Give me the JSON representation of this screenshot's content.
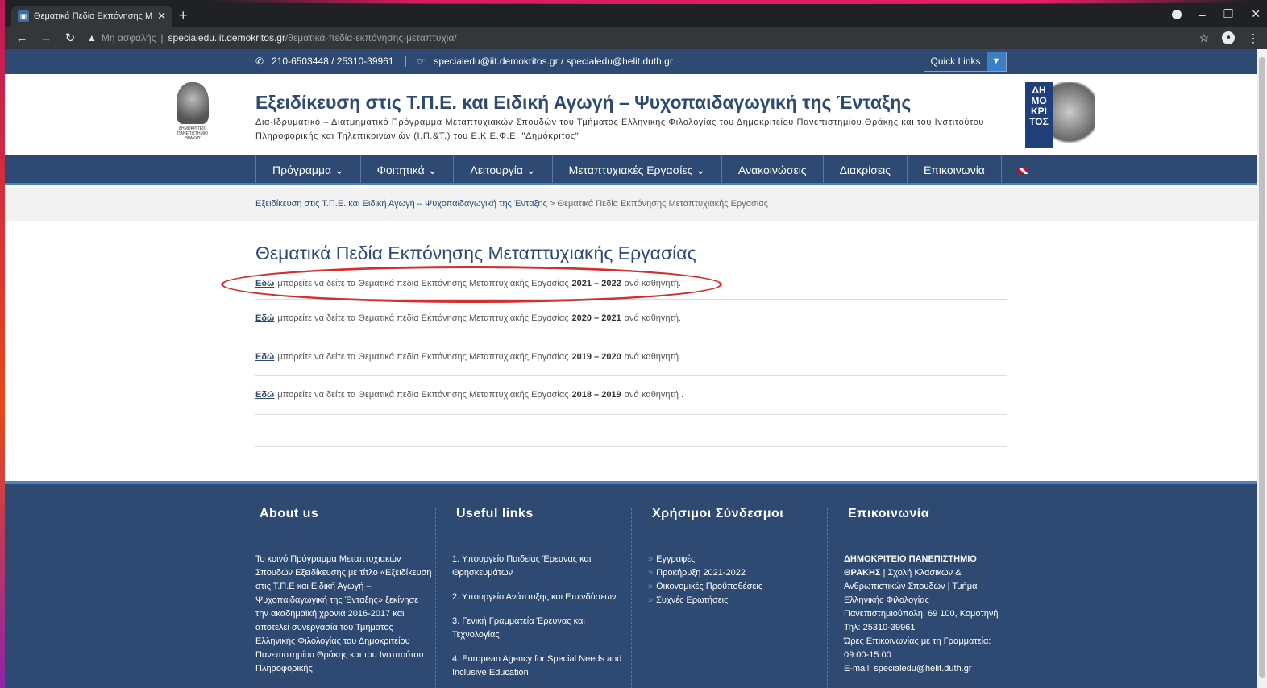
{
  "browser": {
    "tab_title": "Θεματικά Πεδία Εκπόνησης Με",
    "url_warning": "Μη ασφαλής",
    "url_host": "specialedu.iit.demokritos.gr",
    "url_path": "/θεματικά-πεδία-εκπόνησης-μεταπτυχια/"
  },
  "topbar": {
    "phone": "210-6503448 / 25310-39961",
    "email": "specialedu@iit.demokritos.gr / specialedu@helit.duth.gr",
    "quick_links": "Quick Links"
  },
  "header": {
    "title": "Εξειδίκευση στις Τ.Π.Ε. και Ειδική Αγωγή – Ψυχοπαιδαγωγική της Ένταξης",
    "subtitle": "Δια-Ιδρυματικό – Διατμηματικό Πρόγραμμα Μεταπτυχιακών Σπουδών του Τμήματος Ελληνικής Φιλολογίας του Δημοκριτείου Πανεπιστημίου Θράκης και του Ινστιτούτου Πληροφορικής και Τηλεπικοινωνιών (Ι.Π.&Τ.) του Ε.Κ.Ε.Φ.Ε. \"Δημόκριτος\"",
    "logo_left_caption": "ΔΗΜΟΚΡΙΤΕΙΟ ΠΑΝΕΠΙΣΤΗΜΙΟ ΘΡΑΚΗΣ",
    "logo_right_text": "ΔΗ ΜΟ ΚΡΙ ΤΟΣ"
  },
  "nav": {
    "items": [
      "Πρόγραμμα ⌄",
      "Φοιτητικά ⌄",
      "Λειτουργία ⌄",
      "Μεταπτυχιακές Εργασίες ⌄",
      "Ανακοινώσεις",
      "Διακρίσεις",
      "Επικοινωνία"
    ]
  },
  "breadcrumb": {
    "home": "Εξειδίκευση στις Τ.Π.Ε. και Ειδική Αγωγή – Ψυχοπαιδαγωγική της Ένταξης",
    "separator": ">",
    "current": "Θεματικά Πεδία Εκπόνησης Μεταπτυχιακής Εργασίας"
  },
  "content": {
    "title": "Θεματικά Πεδία Εκπόνησης Μεταπτυχιακής Εργασίας",
    "rows": [
      {
        "link": "Εδώ",
        "text": "μπορείτε να δείτε τα Θεματικά πεδία Εκπόνησης Μεταπτυχιακής Εργασίας",
        "years": "2021 – 2022",
        "suffix": "ανά καθηγητή."
      },
      {
        "link": "Εδώ",
        "text": "μπορείτε να δείτε τα Θεματικά πεδία Εκπόνησης Μεταπτυχιακής Εργασίας",
        "years": "2020 – 2021",
        "suffix": "ανά καθηγητή."
      },
      {
        "link": "Εδώ",
        "text": "μπορείτε να δείτε τα Θεματικά πεδία Εκπόνησης Μεταπτυχιακής Εργασίας",
        "years": "2019 – 2020",
        "suffix": "ανά καθηγητή."
      },
      {
        "link": "Εδώ",
        "text": "μπορείτε να δείτε τα Θεματικά πεδία Εκπόνησης Μεταπτυχιακής Εργασίας",
        "years": "2018 – 2019",
        "suffix": "ανά καθηγητή ."
      }
    ]
  },
  "footer": {
    "about": {
      "title": "About us",
      "text": "Το κοινό Πρόγραμμα Μεταπτυχιακών Σπουδών Εξειδίκευσης με τίτλο «Εξειδίκευση στις Τ.Π.Ε και Ειδική Αγωγή – Ψυχοπαιδαγωγική της Ένταξης» ξεκίνησε την ακαδημαϊκή χρονιά 2016-2017 και αποτελεί συνεργασία του Τμήματος Ελληνικής Φιλολογίας του Δημοκριτείου Πανεπιστημίου Θράκης και του Ινστιτούτου Πληροφορικής"
    },
    "useful": {
      "title": "Useful links",
      "links": [
        "1. Υπουργείο Παιδείας Έρευνας και Θρησκευμάτων",
        "2. Υπουργείο Ανάπτυξης και Επενδύσεων",
        "3. Γενική Γραμματεία Έρευνας και Τεχνολογίας",
        "4. European Agency for Special Needs and Inclusive Education"
      ]
    },
    "useful_gr": {
      "title": "Χρήσιμοι Σύνδεσμοι",
      "links": [
        "Εγγραφές",
        "Προκήρυξη 2021-2022",
        "Οικονομικές Προϋποθέσεις",
        "Συχνές Ερωτήσεις"
      ]
    },
    "contact": {
      "title": "Επικοινωνία",
      "org": "ΔΗΜΟΚΡΙΤΕΙΟ ΠΑΝΕΠΙΣΤΗΜΙΟ ΘΡΑΚΗΣ",
      "dept": " | Σχολή Κλασικών & Ανθρωπιστικών Σπουδών | Τμήμα Ελληνικής Φιλολογίας",
      "address": "Πανεπιστημιούπολη, 69 100, Κομοτηνή",
      "phone": "Τηλ: 25310-39961",
      "hours": "Ώρες Επικοινωνίας με τη Γραμματεία: 09:00-15:00",
      "email": "E-mail: specialedu@helit.duth.gr"
    }
  },
  "colors": {
    "primary": "#2e4a72",
    "accent": "#4a86c5",
    "highlight": "#d32f2f"
  }
}
